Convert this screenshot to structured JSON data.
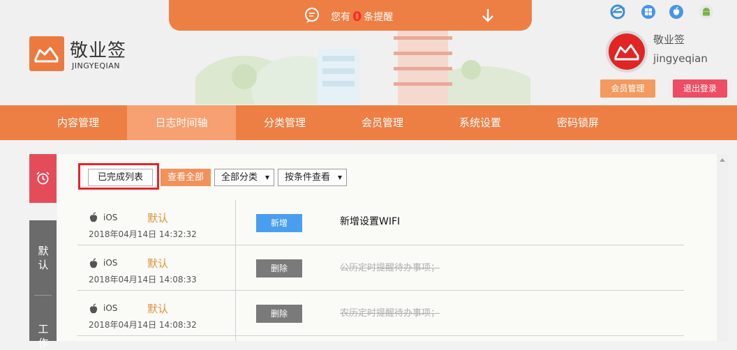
{
  "colors": {
    "accent": "#ee7f44",
    "active_tab": "#f7a071",
    "alarm_tab": "#e54c5a",
    "logout": "#ee4d63",
    "new_button": "#4a9ef0",
    "delete_button": "#7a7a7a",
    "category": "#e3913c"
  },
  "notice": {
    "prefix": "您有",
    "count": "0",
    "suffix": "条提醒"
  },
  "logo": {
    "title": "敬业签",
    "subtitle": "JINGYEQIAN"
  },
  "platforms": [
    "ie-icon",
    "windows-icon",
    "apple-icon",
    "android-icon"
  ],
  "user": {
    "name1": "敬业签",
    "name2": "jingyeqian",
    "member_btn": "会员管理",
    "logout_btn": "退出登录"
  },
  "nav": {
    "items": [
      {
        "label": "内容管理"
      },
      {
        "label": "日志时间轴",
        "active": true
      },
      {
        "label": "分类管理"
      },
      {
        "label": "会员管理"
      },
      {
        "label": "系统设置"
      },
      {
        "label": "密码锁屏"
      }
    ]
  },
  "side": {
    "tab1": "默认",
    "tab2": "工作"
  },
  "toolbar": {
    "completed_list": "已完成列表",
    "view_all": "查看全部",
    "category_select": "全部分类",
    "filter_select": "按条件查看"
  },
  "rows": [
    {
      "platform": "iOS",
      "category": "默认",
      "time": "2018年04月14日 14:32:32",
      "action": "新增",
      "content": "新增设置WIFI"
    },
    {
      "platform": "iOS",
      "category": "默认",
      "time": "2018年04月14日 14:08:33",
      "action": "删除",
      "content": "公历定时提醒待办事项；"
    },
    {
      "platform": "iOS",
      "category": "默认",
      "time": "2018年04月14日 14:08:32",
      "action": "删除",
      "content": "农历定时提醒待办事项；"
    }
  ]
}
